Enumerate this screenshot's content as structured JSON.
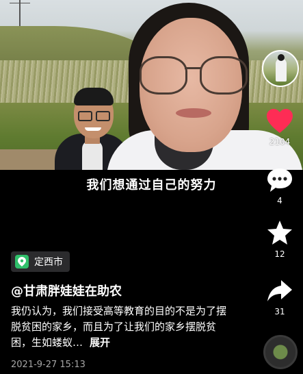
{
  "video": {
    "subtitle": "我们想通过自己的努力"
  },
  "actions": {
    "like_count": "2104",
    "comment_count": "4",
    "favorite_count": "12",
    "share_count": "31"
  },
  "post": {
    "location": "定西市",
    "author": "@甘肃胖娃娃在助农",
    "description": "我仍认为，我们接受高等教育的目的不是为了摆脱贫困的家乡，而且为了让我们的家乡摆脱贫困，生如蝼蚁…",
    "expand_label": "展开",
    "timestamp": "2021-9-27 15:13"
  },
  "icons": {
    "like": "heart-icon",
    "comment": "comment-bubble-icon",
    "favorite": "star-icon",
    "share": "share-arrow-icon",
    "location": "location-pin-icon"
  },
  "colors": {
    "like": "#fe2c55",
    "location_badge": "#2fbf6a",
    "background": "#000000"
  }
}
